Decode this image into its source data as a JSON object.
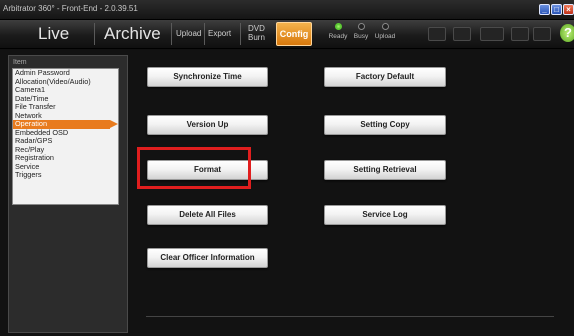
{
  "window": {
    "title": "Arbitrator 360° - Front-End - 2.0.39.51",
    "controls": [
      "minimize",
      "maximize",
      "close"
    ]
  },
  "toolbar": {
    "live": "Live",
    "archive": "Archive",
    "upload": "Upload",
    "export": "Export",
    "dvd_line1": "DVD",
    "dvd_line2": "Burn",
    "config": "Config",
    "status": {
      "ready": "Ready",
      "busy": "Busy",
      "upload": "Upload"
    },
    "help": "?"
  },
  "sidebar": {
    "heading": "Item",
    "items": [
      "Admin Password",
      "Allocation(Video/Audio)",
      "Camera1",
      "Date/Time",
      "File Transfer",
      "Network",
      "Operation",
      "Embedded OSD",
      "Radar/GPS",
      "Rec/Play",
      "Registration",
      "Service",
      "Triggers"
    ],
    "selected": "Operation"
  },
  "buttons": {
    "synchronize_time": "Synchronize Time",
    "factory_default": "Factory Default",
    "version_up": "Version Up",
    "setting_copy": "Setting Copy",
    "format": "Format",
    "setting_retrieval": "Setting Retrieval",
    "delete_all_files": "Delete All Files",
    "service_log": "Service Log",
    "clear_officer_information": "Clear Officer Information"
  },
  "colors": {
    "accent": "#e87b1e",
    "highlight": "#e01e1e",
    "status_ready": "#3aa11c"
  }
}
